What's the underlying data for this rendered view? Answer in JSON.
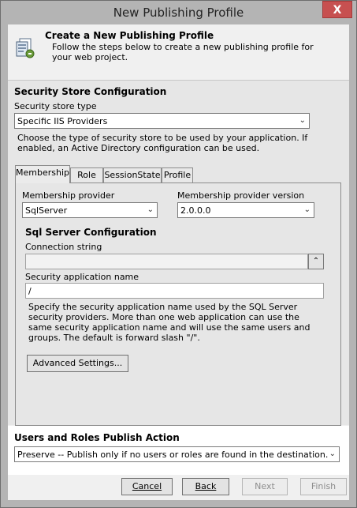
{
  "window": {
    "title": "New Publishing Profile",
    "close_glyph": "X"
  },
  "header": {
    "title": "Create a New Publishing Profile",
    "subtitle": "Follow the steps below to create a new publishing profile for your web project."
  },
  "security_store": {
    "section_title": "Security Store Configuration",
    "type_label": "Security store type",
    "type_value": "Specific IIS Providers",
    "description": "Choose the type of security store to be used by your application. If enabled, an Active Directory configuration can be used."
  },
  "tabs": [
    {
      "label": "Membership",
      "active": true
    },
    {
      "label": "Role"
    },
    {
      "label": "SessionState"
    },
    {
      "label": "Profile"
    }
  ],
  "membership": {
    "provider_label": "Membership provider",
    "provider_value": "SqlServer",
    "version_label": "Membership provider version",
    "version_value": "2.0.0.0",
    "sql_title": "Sql Server Configuration",
    "connection_label": "Connection string",
    "connection_value": "",
    "app_name_label": "Security application name",
    "app_name_value": "/",
    "app_name_description": "Specify the security application name used by the SQL Server security providers. More than one web application can use the same security application name and will use the same users and groups. The default is forward slash \"/\".",
    "advanced_button": "Advanced Settings..."
  },
  "publish_action": {
    "title": "Users and Roles Publish Action",
    "value": "Preserve -- Publish only if no users or roles are found in the destination."
  },
  "footer": {
    "cancel": "Cancel",
    "back": "Back",
    "next": "Next",
    "finish": "Finish"
  },
  "colors": {
    "title_bar": "#b4b4b4",
    "close_button": "#c75050",
    "body_background": "#e6e6e6",
    "disabled_text": "#8d8d8d"
  },
  "icons": {
    "header": "publishing-profile-icon",
    "dropdown": "chevron-down-icon",
    "expand": "chevron-up-icon"
  }
}
